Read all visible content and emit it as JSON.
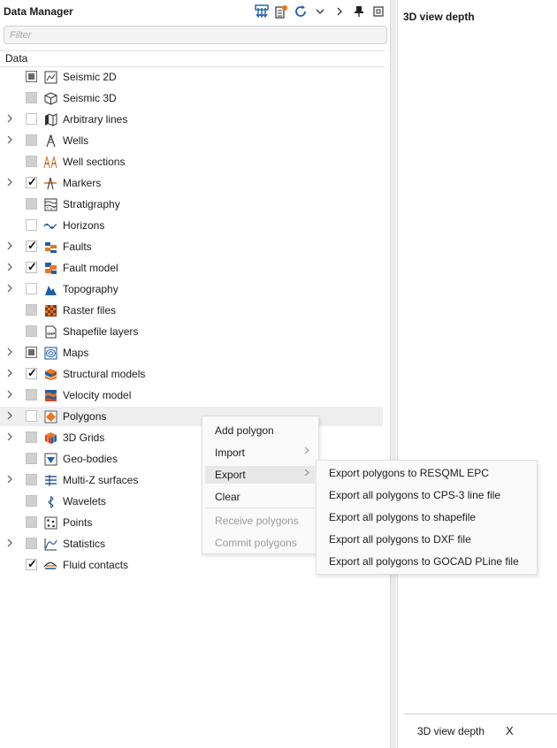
{
  "panel": {
    "title": "Data Manager",
    "filter_placeholder": "Filter",
    "column_header": "Data",
    "toolbar_icons": [
      "add-data-icon",
      "import-icon",
      "refresh-icon",
      "chevron-down-icon",
      "chevron-right-icon",
      "pin-icon",
      "restore-window-icon"
    ]
  },
  "tree": [
    {
      "label": "Seismic 2D",
      "expandable": false,
      "check": "square",
      "icon": "seismic-2d-icon"
    },
    {
      "label": "Seismic 3D",
      "expandable": false,
      "check": "partial",
      "icon": "seismic-3d-icon"
    },
    {
      "label": "Arbitrary lines",
      "expandable": true,
      "check": "unchecked",
      "icon": "arbitrary-lines-icon"
    },
    {
      "label": "Wells",
      "expandable": true,
      "check": "partial",
      "icon": "wells-icon"
    },
    {
      "label": "Well sections",
      "expandable": false,
      "check": "partial",
      "icon": "well-sections-icon"
    },
    {
      "label": "Markers",
      "expandable": true,
      "check": "checked",
      "icon": "markers-icon"
    },
    {
      "label": "Stratigraphy",
      "expandable": false,
      "check": "partial",
      "icon": "stratigraphy-icon"
    },
    {
      "label": "Horizons",
      "expandable": false,
      "check": "unchecked",
      "icon": "horizons-icon"
    },
    {
      "label": "Faults",
      "expandable": true,
      "check": "checked",
      "icon": "faults-icon"
    },
    {
      "label": "Fault model",
      "expandable": true,
      "check": "checked",
      "icon": "fault-model-icon"
    },
    {
      "label": "Topography",
      "expandable": true,
      "check": "unchecked",
      "icon": "topography-icon"
    },
    {
      "label": "Raster files",
      "expandable": false,
      "check": "partial",
      "icon": "raster-files-icon"
    },
    {
      "label": "Shapefile layers",
      "expandable": false,
      "check": "partial",
      "icon": "shapefile-icon"
    },
    {
      "label": "Maps",
      "expandable": true,
      "check": "square",
      "icon": "maps-icon"
    },
    {
      "label": "Structural models",
      "expandable": true,
      "check": "checked",
      "icon": "structural-models-icon"
    },
    {
      "label": "Velocity model",
      "expandable": true,
      "check": "partial",
      "icon": "velocity-model-icon"
    },
    {
      "label": "Polygons",
      "expandable": true,
      "check": "unchecked",
      "icon": "polygons-icon",
      "hover": true
    },
    {
      "label": "3D Grids",
      "expandable": true,
      "check": "partial",
      "icon": "3d-grids-icon"
    },
    {
      "label": "Geo-bodies",
      "expandable": false,
      "check": "partial",
      "icon": "geo-bodies-icon"
    },
    {
      "label": "Multi-Z surfaces",
      "expandable": true,
      "check": "partial",
      "icon": "multi-z-surfaces-icon"
    },
    {
      "label": "Wavelets",
      "expandable": false,
      "check": "partial",
      "icon": "wavelets-icon"
    },
    {
      "label": "Points",
      "expandable": false,
      "check": "partial",
      "icon": "points-icon"
    },
    {
      "label": "Statistics",
      "expandable": true,
      "check": "partial",
      "icon": "statistics-icon"
    },
    {
      "label": "Fluid contacts",
      "expandable": false,
      "check": "checked",
      "icon": "fluid-contacts-icon"
    }
  ],
  "context_menu": [
    {
      "label": "Add polygon",
      "state": "normal",
      "submenu": false
    },
    {
      "label": "Import",
      "state": "normal",
      "submenu": true
    },
    {
      "label": "Export",
      "state": "active",
      "submenu": true
    },
    {
      "label": "Clear",
      "state": "normal",
      "submenu": false
    },
    {
      "label": "Receive polygons",
      "state": "disabled",
      "submenu": false
    },
    {
      "label": "Commit polygons",
      "state": "disabled",
      "submenu": false
    }
  ],
  "export_submenu": [
    "Export polygons to RESQML EPC",
    "Export all polygons to CPS-3 line file",
    "Export all polygons to shapefile",
    "Export all polygons to DXF file",
    "Export all polygons to GOCAD PLine file"
  ],
  "view": {
    "title": "3D view depth",
    "tab_label": "3D view depth",
    "tab_close": "X"
  },
  "colors": {
    "accent_blue": "#1f5fa8",
    "accent_orange": "#e87722"
  }
}
